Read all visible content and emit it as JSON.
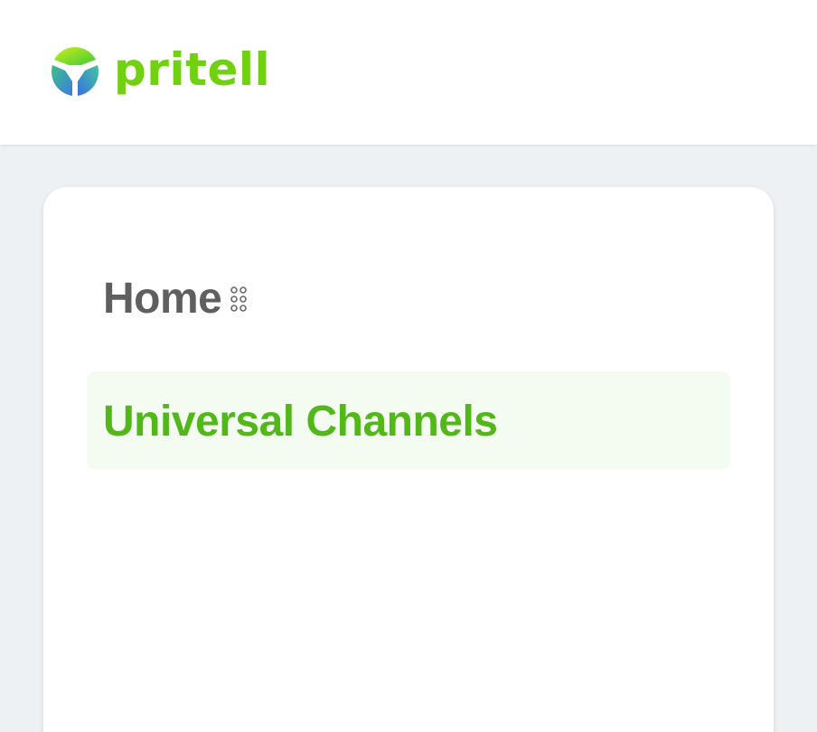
{
  "header": {
    "logo_text": "pritell",
    "logo_icon": "pritell-logo-icon",
    "brand_color": "#6fd10f"
  },
  "menu": {
    "home_label": "Home",
    "home_icon": "apps-grid-icon",
    "active_item_label": "Universal Channels",
    "active_color": "#52b81a",
    "active_bg": "#f4fbf0"
  }
}
